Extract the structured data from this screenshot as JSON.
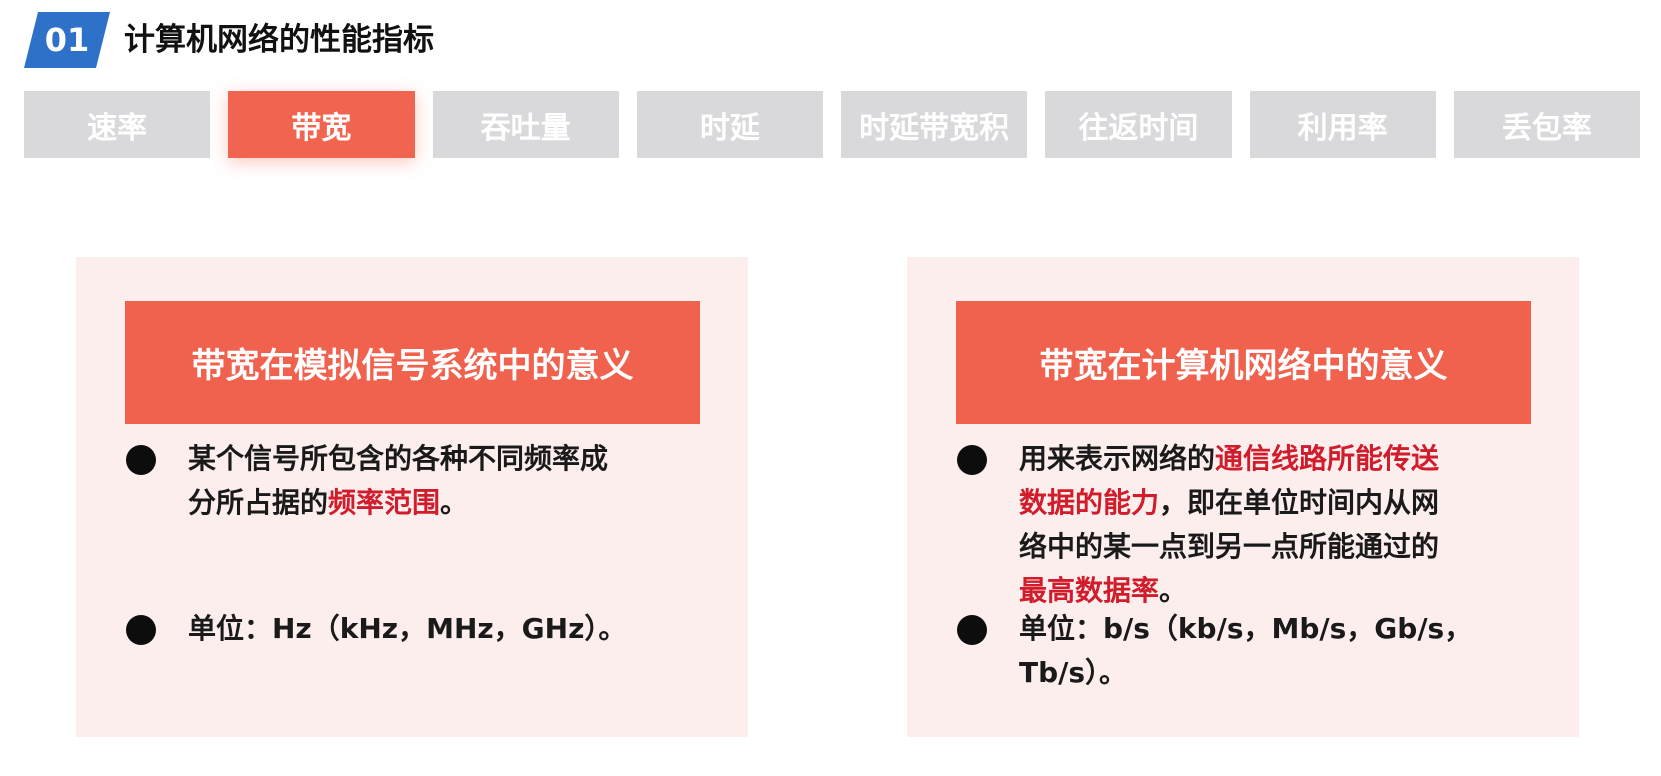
{
  "header": {
    "badge": "01",
    "title": "计算机网络的性能指标"
  },
  "tabs": [
    {
      "label": "速率",
      "active": false
    },
    {
      "label": "带宽",
      "active": true
    },
    {
      "label": "吞吐量",
      "active": false
    },
    {
      "label": "时延",
      "active": false
    },
    {
      "label": "时延带宽积",
      "active": false
    },
    {
      "label": "往返时间",
      "active": false
    },
    {
      "label": "利用率",
      "active": false
    },
    {
      "label": "丢包率",
      "active": false
    }
  ],
  "left_card": {
    "header": "带宽在模拟信号系统中的意义",
    "bullet1": {
      "line1": "某个信号所包含的各种不同频率成",
      "line2_pre": "分所占据的",
      "line2_hl": "频率范围",
      "line2_post": "。"
    },
    "bullet2": "单位：Hz（kHz，MHz，GHz）。"
  },
  "right_card": {
    "header": "带宽在计算机网络中的意义",
    "bullet1": {
      "line1_pre": "用来表示网络的",
      "line1_hl": "通信线路所能传送",
      "line2_hl": "数据的能力",
      "line2_post": "，即在单位时间内从网",
      "line3": "络中的某一点到另一点所能通过的",
      "line4_hl": "最高数据率",
      "line4_post": "。"
    },
    "bullet2": "单位：b/s（kb/s，Mb/s，Gb/s，Tb/s）。"
  },
  "colors": {
    "accent": "#f06450",
    "badge": "#2d72c8",
    "tab_inactive": "#d9d9dc",
    "card_bg": "#fdeeee",
    "highlight": "#d01c2b"
  }
}
